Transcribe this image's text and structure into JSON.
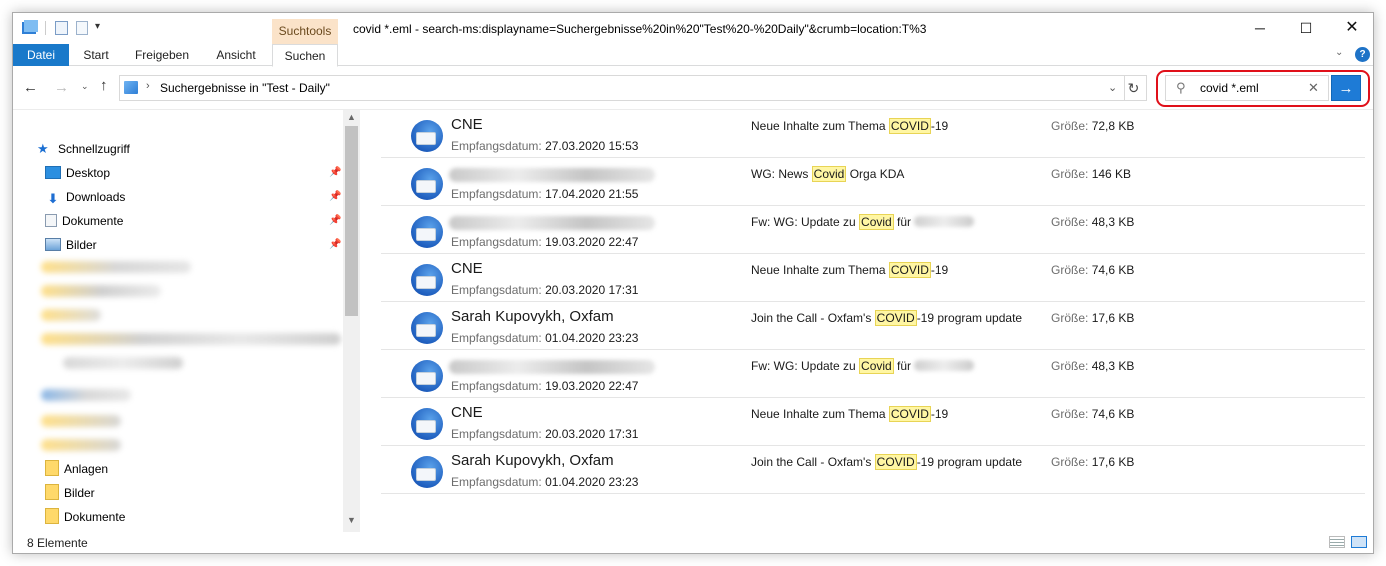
{
  "window": {
    "title": "covid *.eml - search-ms:displayname=Suchergebnisse%20in%20\"Test%20-%20Daily\"&crumb=location:T%3",
    "context_tab": "Suchtools",
    "controls": {
      "minimize": "─",
      "maximize": "☐",
      "close": "✕"
    }
  },
  "quick_access_toolbar": {
    "dropdown": "▾"
  },
  "ribbon": {
    "tabs": [
      "Datei",
      "Start",
      "Freigeben",
      "Ansicht",
      "Suchen"
    ],
    "collapse_glyph": "⌄",
    "help": "?"
  },
  "navigation": {
    "back": "←",
    "forward": "→",
    "recent": "⌄",
    "up": "↑",
    "address_chevron": "›",
    "address_text": "Suchergebnisse in \"Test - Daily\"",
    "address_dropdown": "⌄",
    "refresh": "↻"
  },
  "search": {
    "value": "covid *.eml",
    "icon": "⚲",
    "clear": "✕",
    "go": "→"
  },
  "nav_pane": {
    "quick_access": "Schnellzugriff",
    "pinned": [
      {
        "label": "Desktop",
        "icon": "desktop-icon"
      },
      {
        "label": "Downloads",
        "icon": "download-icon"
      },
      {
        "label": "Dokumente",
        "icon": "documents-icon"
      },
      {
        "label": "Bilder",
        "icon": "pictures-icon"
      }
    ],
    "pin_glyph": "📌",
    "folders": [
      {
        "label": "Anlagen",
        "icon": "folder-icon"
      },
      {
        "label": "Bilder",
        "icon": "folder-icon"
      },
      {
        "label": "Dokumente",
        "icon": "folder-icon"
      }
    ],
    "scroll_up": "▲",
    "scroll_down": "▼"
  },
  "results": {
    "date_label": "Empfangsdatum:",
    "size_label": "Größe:",
    "items": [
      {
        "sender": "CNE",
        "date": "27.03.2020 15:53",
        "subject_pre": "Neue Inhalte zum Thema ",
        "subject_hl": "COVID",
        "subject_post": "-19",
        "size": "72,8 KB"
      },
      {
        "sender": "",
        "date": "17.04.2020 21:55",
        "subject_pre": "WG: News ",
        "subject_hl": "Covid",
        "subject_post": " Orga KDA",
        "size": "146 KB"
      },
      {
        "sender": "",
        "date": "19.03.2020 22:47",
        "subject_pre": "Fw: WG: Update zu ",
        "subject_hl": "Covid",
        "subject_post": " für ",
        "size": "48,3 KB"
      },
      {
        "sender": "CNE",
        "date": "20.03.2020 17:31",
        "subject_pre": "Neue Inhalte zum Thema ",
        "subject_hl": "COVID",
        "subject_post": "-19",
        "size": "74,6 KB"
      },
      {
        "sender": "Sarah Kupovykh, Oxfam",
        "date": "01.04.2020 23:23",
        "subject_pre": "Join the Call - Oxfam's ",
        "subject_hl": "COVID",
        "subject_post": "-19 program update",
        "size": "17,6 KB"
      },
      {
        "sender": "",
        "date": "19.03.2020 22:47",
        "subject_pre": "Fw: WG: Update zu ",
        "subject_hl": "Covid",
        "subject_post": " für ",
        "size": "48,3 KB"
      },
      {
        "sender": "CNE",
        "date": "20.03.2020 17:31",
        "subject_pre": "Neue Inhalte zum Thema ",
        "subject_hl": "COVID",
        "subject_post": "-19",
        "size": "74,6 KB"
      },
      {
        "sender": "Sarah Kupovykh, Oxfam",
        "date": "01.04.2020 23:23",
        "subject_pre": "Join the Call - Oxfam's ",
        "subject_hl": "COVID",
        "subject_post": "-19 program update",
        "size": "17,6 KB"
      }
    ]
  },
  "status": {
    "count": "8 Elemente"
  },
  "colors": {
    "accent": "#1979ca",
    "highlight_outline": "#e0101a",
    "context_tab": "#fbe3c9",
    "search_highlight": "#fff6a3"
  }
}
